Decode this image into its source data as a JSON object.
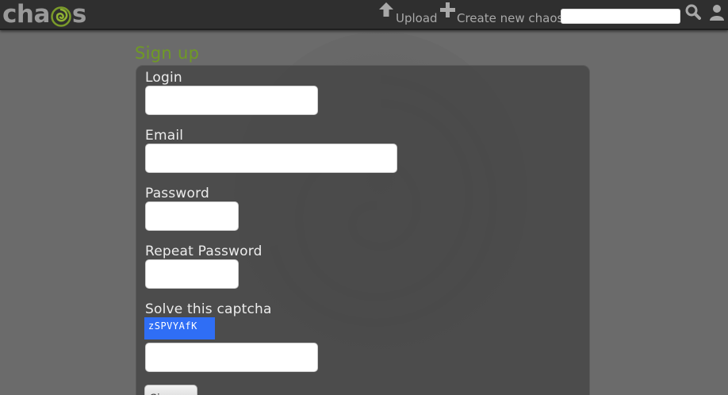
{
  "header": {
    "logo_prefix": "cha",
    "logo_suffix": "s",
    "upload_label": "Upload",
    "create_label": "Create new chaos",
    "search_value": "",
    "search_placeholder": ""
  },
  "icons": {
    "upload": "arrow-up-icon",
    "create": "plus-icon",
    "search": "search-icon",
    "user": "user-icon",
    "logo": "chaos-swirl-logo-icon"
  },
  "form": {
    "title": "Sign up",
    "login_label": "Login",
    "login_value": "",
    "email_label": "Email",
    "email_value": "",
    "password_label": "Password",
    "password_value": "",
    "repeat_password_label": "Repeat Password",
    "repeat_password_value": "",
    "captcha_label": "Solve this captcha",
    "captcha_text": "zSPVYAfK",
    "captcha_value": "",
    "submit_label": "Sign up"
  },
  "colors": {
    "accent_green": "#6f9a24",
    "captcha_blue": "#2f6ef5",
    "topbar": "#2f2f2f",
    "background": "#6b6b6b"
  }
}
